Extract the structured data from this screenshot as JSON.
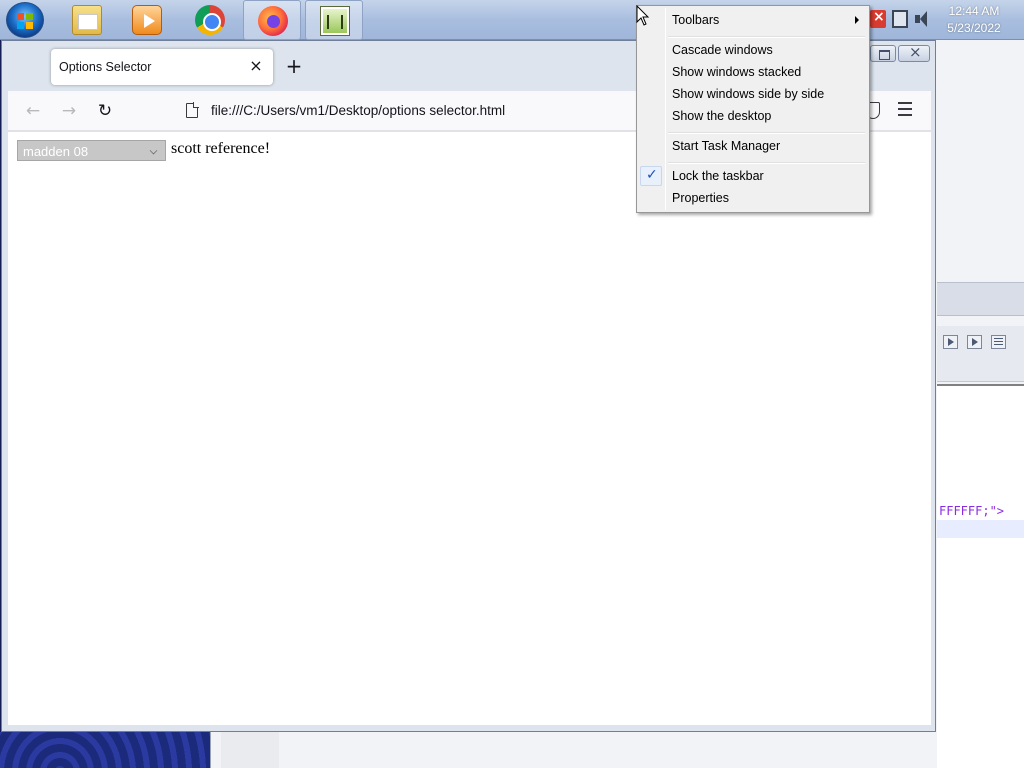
{
  "taskbar": {
    "pinned": [
      {
        "name": "start-button",
        "icon": "windows-logo-icon"
      },
      {
        "name": "file-explorer",
        "icon": "folder-icon"
      },
      {
        "name": "media-player",
        "icon": "media-player-icon"
      },
      {
        "name": "chrome",
        "icon": "chrome-icon"
      },
      {
        "name": "firefox",
        "icon": "firefox-icon"
      },
      {
        "name": "notepad-plus-plus",
        "icon": "notepad-icon"
      }
    ],
    "clock": {
      "time": "12:44 AM",
      "date": "5/23/2022"
    }
  },
  "browser": {
    "tab_title": "Options Selector",
    "tab_close": "×",
    "new_tab": "+",
    "url": "file:///C:/Users/vm1/Desktop/options selector.html"
  },
  "page": {
    "select_value": "madden 08",
    "reference_text": "scott reference!"
  },
  "context_menu": {
    "items": [
      {
        "label": "Toolbars",
        "has_submenu": true
      },
      {
        "label": "Cascade windows"
      },
      {
        "label": "Show windows stacked"
      },
      {
        "label": "Show windows side by side"
      },
      {
        "label": "Show the desktop"
      },
      {
        "label": "Start Task Manager"
      },
      {
        "label": "Lock the taskbar",
        "checked": true
      },
      {
        "label": "Properties"
      }
    ]
  },
  "background_editor": {
    "code_fragment": "FFFFFF;\">"
  },
  "colors": {
    "taskbar": "#a9bedf",
    "menu_bg": "#f0f0f0",
    "select_bg": "#c7c7c7",
    "code_color": "#8a2be2"
  }
}
